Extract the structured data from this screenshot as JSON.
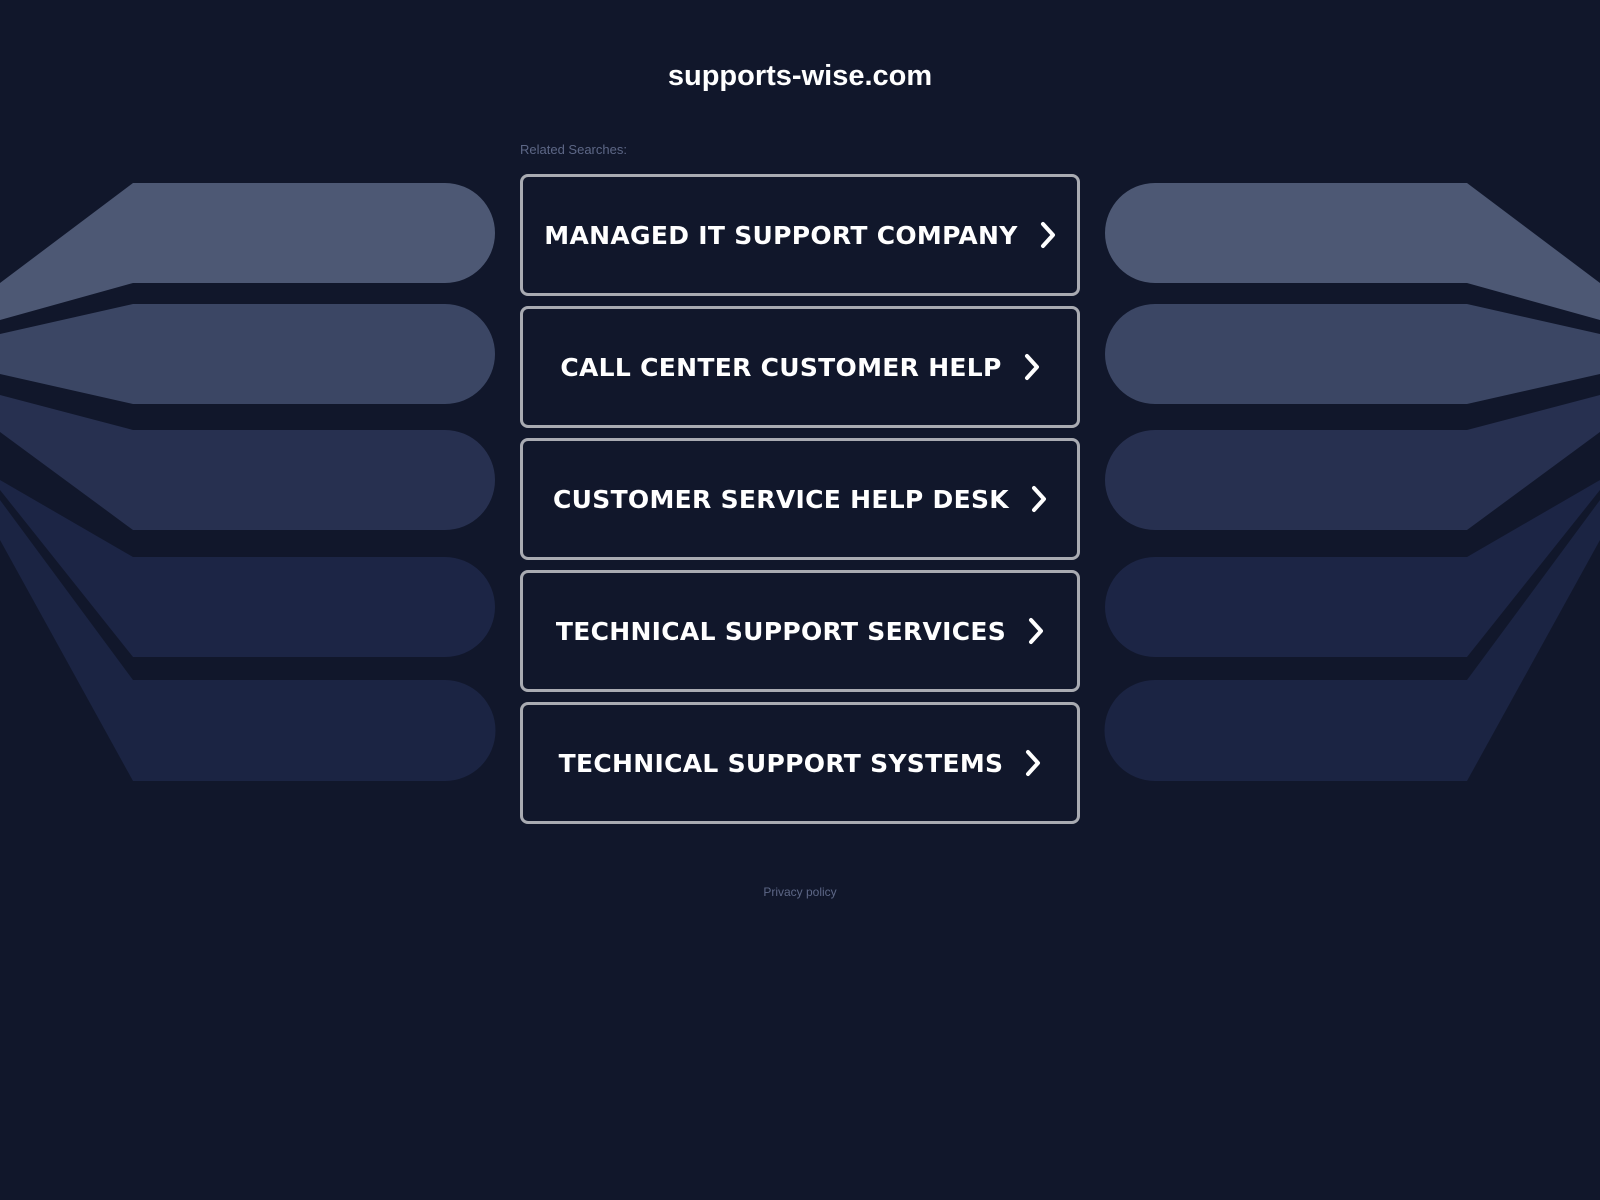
{
  "header": {
    "domain": "supports-wise.com"
  },
  "related": {
    "label": "Related Searches:",
    "items": [
      {
        "label": "MANAGED IT SUPPORT COMPANY"
      },
      {
        "label": "CALL CENTER CUSTOMER HELP"
      },
      {
        "label": "CUSTOMER SERVICE HELP DESK"
      },
      {
        "label": "TECHNICAL SUPPORT SERVICES"
      },
      {
        "label": "TECHNICAL SUPPORT SYSTEMS"
      }
    ]
  },
  "footer": {
    "privacy_label": "Privacy policy"
  },
  "colors": {
    "background": "#11172b",
    "button_border": "#a9abb2",
    "muted_text": "#5d6786",
    "decor_shades": [
      "#4d5874",
      "#3b4664",
      "#273050",
      "#1c2545",
      "#1b2443"
    ]
  }
}
